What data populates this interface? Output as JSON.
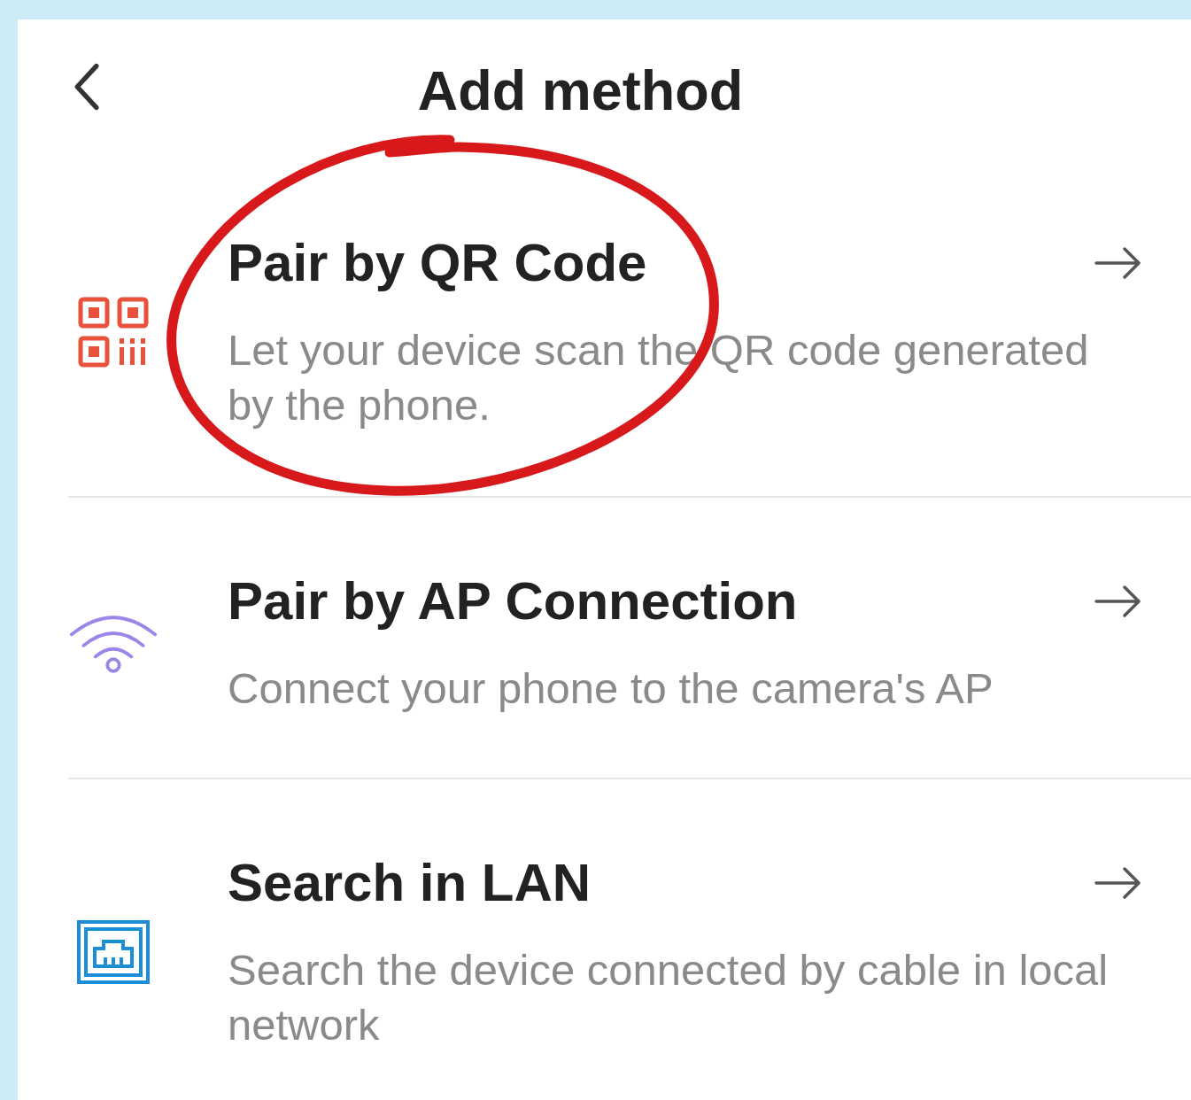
{
  "header": {
    "title": "Add method"
  },
  "methods": [
    {
      "kind": "qr",
      "title": "Pair by QR Code",
      "description": "Let your device scan the QR code generated by the phone.",
      "highlighted": true
    },
    {
      "kind": "ap",
      "title": "Pair by AP Connection",
      "description": "Connect your phone to the camera's AP",
      "highlighted": false
    },
    {
      "kind": "lan",
      "title": "Search in LAN",
      "description": "Search the device connected by cable in local network",
      "highlighted": false
    }
  ]
}
